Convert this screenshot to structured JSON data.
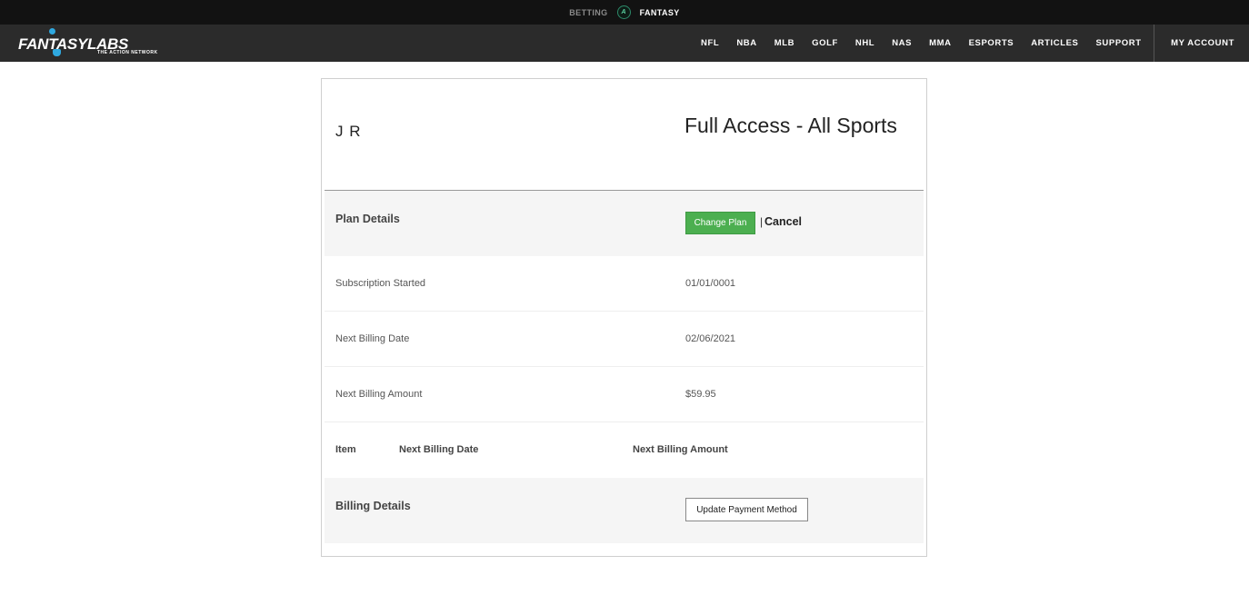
{
  "topbar": {
    "betting_label": "BETTING",
    "fantasy_label": "FANTASY",
    "logo_icon": "action-network-icon"
  },
  "logo": {
    "brand": "FANTASYLABS",
    "sub": "THE ACTION NETWORK"
  },
  "nav": {
    "items": [
      "NFL",
      "NBA",
      "MLB",
      "GOLF",
      "NHL",
      "NAS",
      "MMA",
      "ESPORTS",
      "ARTICLES",
      "SUPPORT"
    ],
    "account": "MY ACCOUNT"
  },
  "account": {
    "user_name": "J R",
    "plan_name": "Full Access - All Sports",
    "plan_details_label": "Plan Details",
    "change_plan_label": "Change Plan",
    "separator": "|",
    "cancel_label": "Cancel",
    "rows": [
      {
        "label": "Subscription Started",
        "value": "01/01/0001"
      },
      {
        "label": "Next Billing Date",
        "value": "02/06/2021"
      },
      {
        "label": "Next Billing Amount",
        "value": "$59.95"
      }
    ],
    "items_table": {
      "headers": [
        "Item",
        "Next Billing Date",
        "Next Billing Amount"
      ]
    },
    "billing_details_label": "Billing Details",
    "update_payment_label": "Update Payment Method"
  },
  "colors": {
    "accent_green": "#4caf50",
    "navbar": "#2b2b2b",
    "topbar": "#121212"
  }
}
